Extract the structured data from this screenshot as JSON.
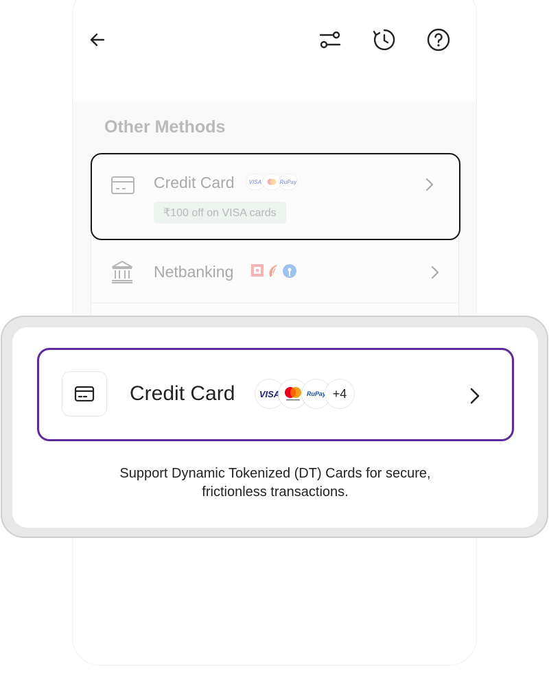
{
  "header": {
    "back_icon": "arrow-left-icon",
    "filter_icon": "sliders-icon",
    "history_icon": "clock-history-icon",
    "help_icon": "question-circle-icon"
  },
  "methods": {
    "title": "Other Methods",
    "credit_card": {
      "label": "Credit Card",
      "offer": "₹100 off on VISA cards",
      "badges": [
        "VISA",
        "",
        "RuPay"
      ]
    },
    "netbanking": {
      "label": "Netbanking"
    }
  },
  "callout": {
    "option": {
      "label": "Credit Card",
      "badges": [
        "VISA",
        "",
        "RuPay",
        "+4"
      ]
    },
    "description_line1": "Support Dynamic Tokenized (DT) Cards for secure,",
    "description_line2": "frictionless transactions."
  },
  "colors": {
    "accent": "#5b2a9e",
    "mastercard_red": "#eb001b",
    "mastercard_orange": "#f79e1b",
    "visa_blue": "#1a1f71"
  }
}
